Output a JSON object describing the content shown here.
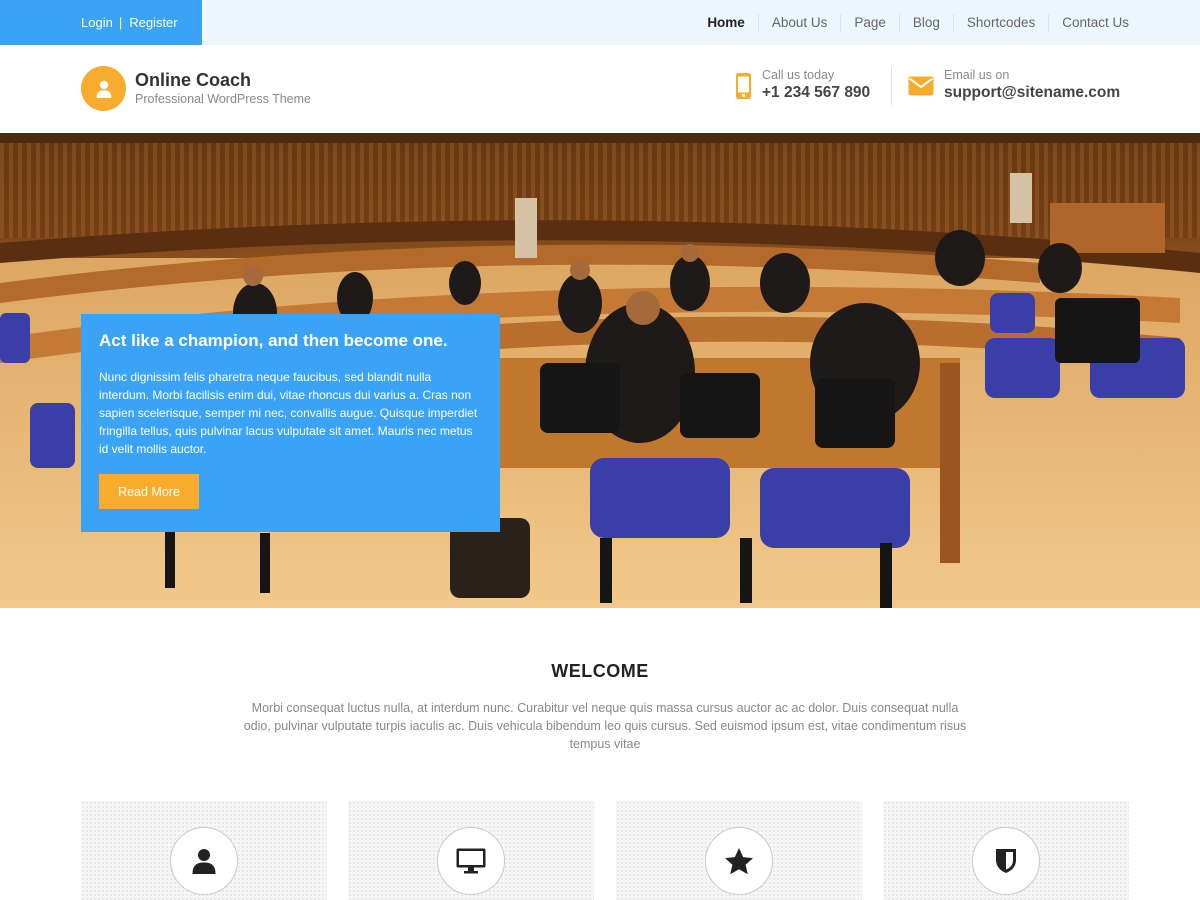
{
  "topbar": {
    "login_label": "Login",
    "separator": "|",
    "register_label": "Register",
    "nav": [
      "Home",
      "About Us",
      "Page",
      "Blog",
      "Shortcodes",
      "Contact Us"
    ],
    "active_nav": "Home"
  },
  "header": {
    "site_title": "Online Coach",
    "tagline": "Professional WordPress Theme",
    "logo_icon": "user-icon",
    "call_label": "Call us today",
    "call_value": "+1 234 567 890",
    "call_icon": "phone-icon",
    "mail_label": "Email us on",
    "mail_value": "support@sitename.com",
    "mail_icon": "envelope-icon"
  },
  "hero": {
    "title": "Act like a champion, and then become one.",
    "text": "Nunc dignissim felis pharetra neque faucibus, sed blandit nulla interdum. Morbi facilisis enim dui, vitae rhoncus dui varius a. Cras non sapien scelerisque, semper mi nec, convallis augue. Quisque imperdiet fringilla tellus, quis pulvinar lacus vulputate sit amet. Mauris nec metus id velit mollis auctor.",
    "button_label": "Read More"
  },
  "welcome": {
    "title": "WELCOME",
    "text": "Morbi consequat luctus nulla, at interdum nunc. Curabitur vel neque quis massa cursus auctor ac ac dolor. Duis consequat nulla odio, pulvinar vulputate turpis iaculis ac. Duis vehicula bibendum leo quis cursus. Sed euismod ipsum est, vitae condimentum risus tempus vitae"
  },
  "features": [
    {
      "icon": "user-icon"
    },
    {
      "icon": "monitor-icon"
    },
    {
      "icon": "star-icon"
    },
    {
      "icon": "shield-icon"
    }
  ],
  "colors": {
    "accent_blue": "#3aa3f5",
    "accent_orange": "#f8ac2e",
    "topbar_bg": "#ecf6fe"
  }
}
